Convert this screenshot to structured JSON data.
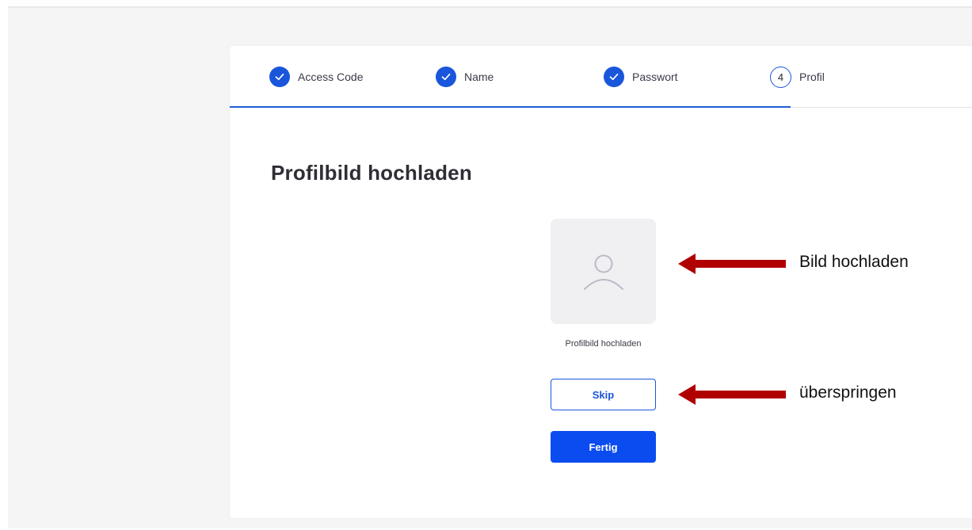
{
  "stepper": {
    "steps": [
      {
        "label": "Access Code",
        "state": "complete",
        "icon": "check-icon"
      },
      {
        "label": "Name",
        "state": "complete",
        "icon": "check-icon"
      },
      {
        "label": "Passwort",
        "state": "complete",
        "icon": "check-icon"
      },
      {
        "number": "4",
        "label": "Profil",
        "state": "current"
      }
    ]
  },
  "main": {
    "title": "Profilbild hochladen",
    "avatar_icon": "user-icon",
    "upload_caption": "Profilbild hochladen",
    "skip_label": "Skip",
    "done_label": "Fertig"
  },
  "annotations": {
    "upload_note": "Bild hochladen",
    "skip_note": "überspringen",
    "arrow_color": "#b00000"
  },
  "colors": {
    "accent": "#1a56db",
    "primary_button": "#0b4cf0",
    "page_background": "#f5f5f5"
  }
}
